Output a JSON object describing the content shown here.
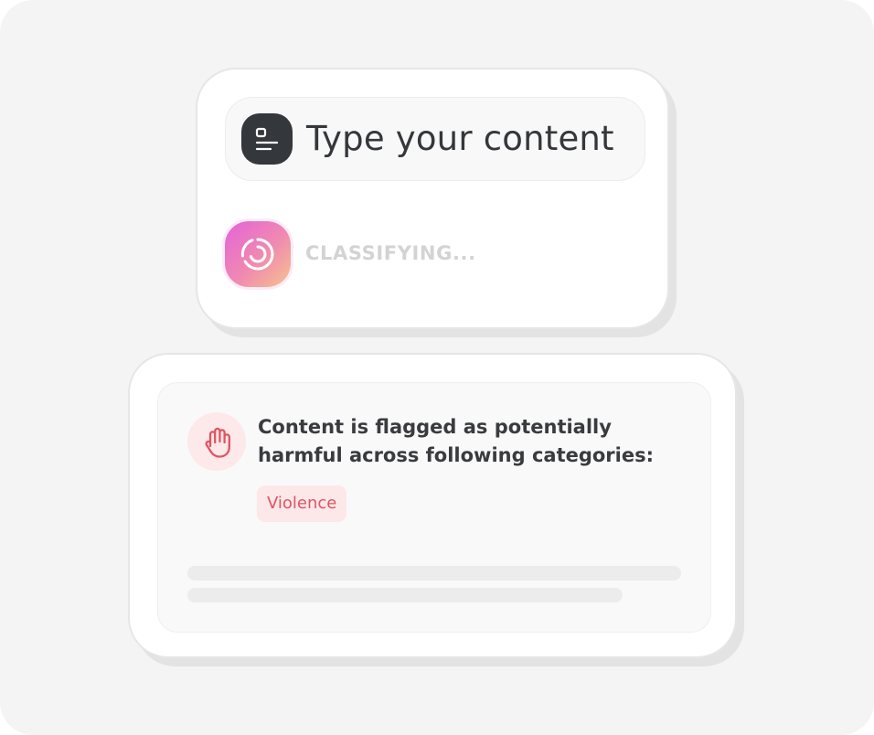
{
  "input": {
    "icon": "text-document-icon",
    "placeholder_text": "Type your content"
  },
  "status": {
    "icon": "spinner-icon",
    "text": "CLASSIFYING..."
  },
  "result": {
    "icon": "raised-hand-icon",
    "message": "Content is flagged as potentially harmful across following categories:",
    "categories": [
      "Violence"
    ]
  },
  "colors": {
    "icon_dark": "#34373b",
    "spinner_gradient": [
      "#e463d9",
      "#f08ab0",
      "#f6c38c"
    ],
    "flag_red": "#e05461",
    "flag_tint": "#fde8e9",
    "status_gray": "#d3d3d3"
  }
}
